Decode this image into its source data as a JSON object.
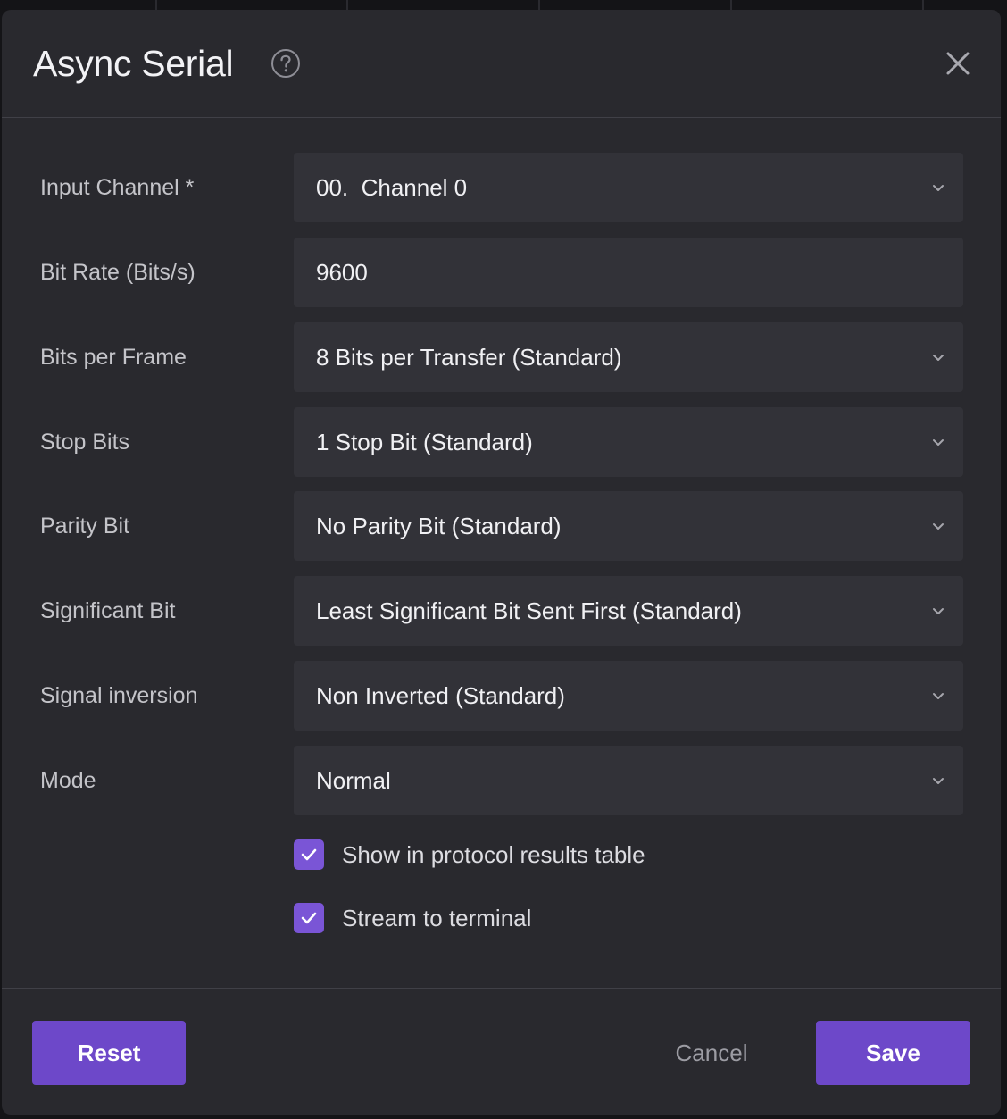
{
  "dialog": {
    "title": "Async Serial"
  },
  "fields": [
    {
      "label": "Input Channel *",
      "value": "00.  Channel 0",
      "type": "select"
    },
    {
      "label": "Bit Rate (Bits/s)",
      "value": "9600",
      "type": "input"
    },
    {
      "label": "Bits per Frame",
      "value": "8 Bits per Transfer (Standard)",
      "type": "select"
    },
    {
      "label": "Stop Bits",
      "value": "1 Stop Bit (Standard)",
      "type": "select"
    },
    {
      "label": "Parity Bit",
      "value": "No Parity Bit (Standard)",
      "type": "select"
    },
    {
      "label": "Significant Bit",
      "value": "Least Significant Bit Sent First (Standard)",
      "type": "select"
    },
    {
      "label": "Signal inversion",
      "value": "Non Inverted (Standard)",
      "type": "select"
    },
    {
      "label": "Mode",
      "value": "Normal",
      "type": "select"
    }
  ],
  "checkboxes": [
    {
      "label": "Show in protocol results table",
      "checked": true
    },
    {
      "label": "Stream to terminal",
      "checked": true
    }
  ],
  "footer": {
    "reset_label": "Reset",
    "cancel_label": "Cancel",
    "save_label": "Save"
  },
  "colors": {
    "accent": "#6d48c9",
    "dialog_bg": "#29292e",
    "field_bg": "#323238"
  }
}
